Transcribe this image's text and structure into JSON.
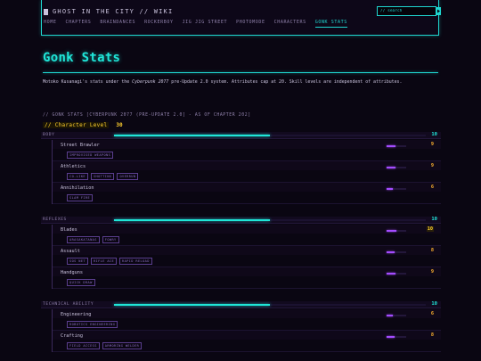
{
  "site": {
    "title": "GHOST IN THE CITY // WIKI",
    "search_placeholder": "// search",
    "search_icon": "arrow-right-icon",
    "nav": [
      {
        "label": "HOME",
        "active": false
      },
      {
        "label": "CHAPTERS",
        "active": false
      },
      {
        "label": "BRAINDANCES",
        "active": false
      },
      {
        "label": "ROCKERBOY",
        "active": false
      },
      {
        "label": "JIG JIG STREET",
        "active": false
      },
      {
        "label": "PHOTOMODE",
        "active": false
      },
      {
        "label": "CHARACTERS",
        "active": false
      },
      {
        "label": "GONK STATS",
        "active": true
      }
    ]
  },
  "page": {
    "title": "Gonk Stats",
    "intro_pre": "Motoko Kusanagi's stats under the ",
    "intro_em": "Cyberpunk 2077",
    "intro_post": " pre-Update 2.0 system. Attributes cap at 20. Skill levels are independent of attributes."
  },
  "stats": {
    "section_header": "// GONK STATS [CYBERPUNK 2077 (PRE-UPDATE 2.0] - AS OF CHAPTER 202]",
    "character_level_label": "// Character Level",
    "character_level": "30",
    "attribute_cap": 20,
    "skill_cap": 20,
    "attributes": [
      {
        "name": "BODY",
        "value": "10",
        "level": 10,
        "skills": [
          {
            "name": "Street Brawler",
            "value": "9",
            "level": 9,
            "max": false,
            "tags": [
              "IMPROVISED WEAPONS"
            ]
          },
          {
            "name": "Athletics",
            "value": "9",
            "level": 9,
            "max": false,
            "tags": [
              "CO-LIKE",
              "SHOTTING",
              "OVERRUN"
            ]
          },
          {
            "name": "Annihilation",
            "value": "6",
            "level": 6,
            "max": false,
            "tags": [
              "SLAM FIRE"
            ]
          }
        ]
      },
      {
        "name": "REFLEXES",
        "value": "10",
        "level": 10,
        "skills": [
          {
            "name": "Blades",
            "value": "10",
            "level": 10,
            "max": true,
            "tags": [
              "ARASAKATANAS",
              "FOWRY"
            ]
          },
          {
            "name": "Assault",
            "value": "8",
            "level": 8,
            "max": false,
            "tags": [
              "SOS NET",
              "RIFLE ACE",
              "RAPID RELOAD"
            ]
          },
          {
            "name": "Handguns",
            "value": "9",
            "level": 9,
            "max": false,
            "tags": [
              "QUICK DRAW"
            ]
          }
        ]
      },
      {
        "name": "TECHNICAL ABILITY",
        "value": "10",
        "level": 10,
        "skills": [
          {
            "name": "Engineering",
            "value": "6",
            "level": 6,
            "max": false,
            "tags": [
              "ROBOTICS ENGINEERING"
            ]
          },
          {
            "name": "Crafting",
            "value": "8",
            "level": 8,
            "max": false,
            "tags": [
              "FIELD ACCESS",
              "ARMORING WELDER"
            ]
          }
        ]
      }
    ]
  },
  "colors": {
    "accent": "#1fe6d8",
    "skill_bar": "#a44cff",
    "value": "#ffb22e",
    "highlight": "#ffcf2e"
  }
}
